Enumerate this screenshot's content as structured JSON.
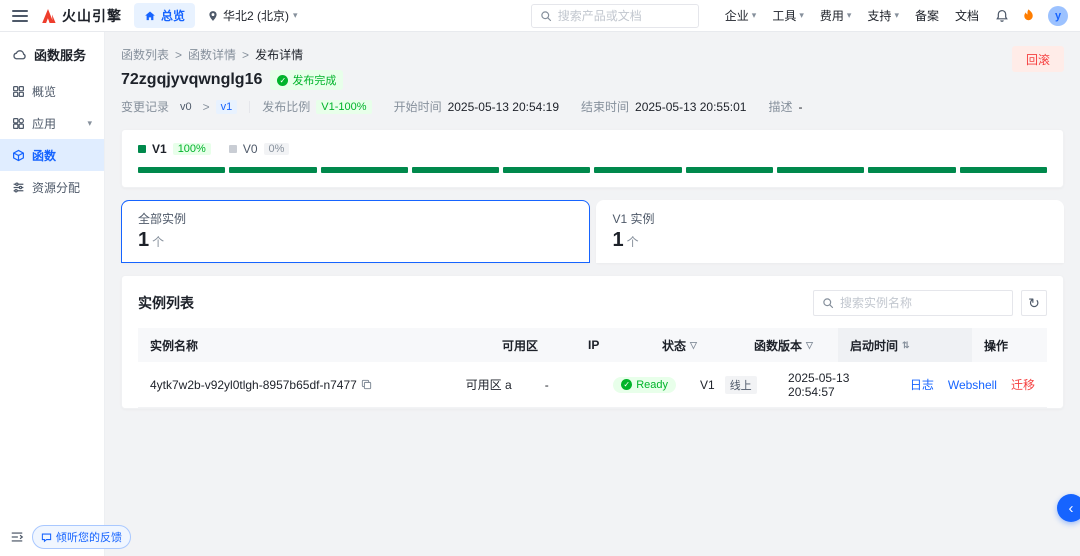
{
  "colors": {
    "primary": "#1664FF",
    "success": "#00B42A",
    "success_dark": "#00894C",
    "danger": "#F53F3F",
    "brand_red": "#EE3D2C",
    "page_bg": "#F2F3F5"
  },
  "icons": {
    "caret_down": "▾",
    "breadcrumb_sep": ">",
    "check": "✓",
    "filter": "▽",
    "sort": "⇅",
    "refresh": "↻",
    "chevron_left": "‹"
  },
  "topbar": {
    "brand": "火山引擎",
    "overview": "总览",
    "region": "华北2 (北京)",
    "search_placeholder": "搜索产品或文档",
    "menu": [
      {
        "label": "企业"
      },
      {
        "label": "工具"
      },
      {
        "label": "费用"
      },
      {
        "label": "支持"
      },
      {
        "label": "备案"
      },
      {
        "label": "文档"
      }
    ],
    "avatar_text": "y"
  },
  "sidebar": {
    "title": "函数服务",
    "items": [
      {
        "label": "概览"
      },
      {
        "label": "应用"
      },
      {
        "label": "函数"
      },
      {
        "label": "资源分配"
      }
    ],
    "feedback": "倾听您的反馈"
  },
  "main": {
    "breadcrumb": [
      "函数列表",
      "函数详情",
      "发布详情"
    ],
    "title": "72zgqjyvqwnglg16",
    "release_status": "发布完成",
    "meta": {
      "change_label": "变更记录",
      "change_from": "v0",
      "change_to": "v1",
      "ratio_label": "发布比例",
      "ratio_value": "V1-100%",
      "start_label": "开始时间",
      "start_value": "2025-05-13 20:54:19",
      "end_label": "结束时间",
      "end_value": "2025-05-13 20:55:01",
      "desc_label": "描述",
      "desc_value": "-"
    },
    "rollback": "回滚",
    "progress": {
      "v1_label": "V1",
      "v1_percent": "100%",
      "v0_label": "V0",
      "v0_percent": "0%",
      "segments": 10
    },
    "tabs": [
      {
        "label": "全部实例",
        "count": "1",
        "unit": "个"
      },
      {
        "label": "V1 实例",
        "count": "1",
        "unit": "个"
      }
    ],
    "instances": {
      "title": "实例列表",
      "search_placeholder": "搜索实例名称",
      "columns": {
        "name": "实例名称",
        "zone": "可用区",
        "ip": "IP",
        "status": "状态",
        "version": "函数版本",
        "start_time": "启动时间",
        "actions": "操作"
      },
      "rows": [
        {
          "name": "4ytk7w2b-v92yl0tlgh-8957b65df-n7477",
          "zone": "可用区 a",
          "ip": "-",
          "status": "Ready",
          "version": "V1",
          "version_tag": "线上",
          "start_time": "2025-05-13 20:54:57",
          "action_log": "日志",
          "action_webshell": "Webshell",
          "action_migrate": "迁移"
        }
      ]
    }
  }
}
